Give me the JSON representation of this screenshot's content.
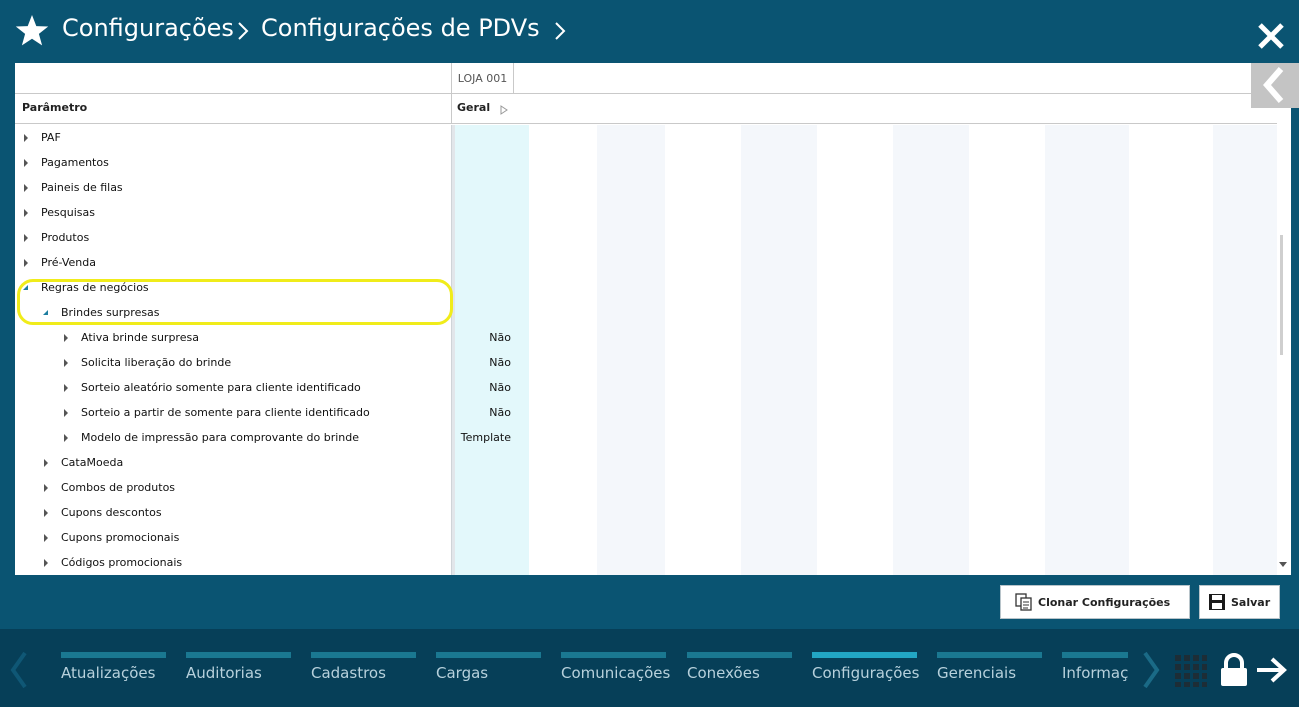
{
  "header": {
    "crumbs": [
      "Configurações",
      "Configurações de PDVs"
    ]
  },
  "table": {
    "store_column": "LOJA 001",
    "param_header": "Parâmetro",
    "group_header": "Geral",
    "rows": [
      {
        "label": "PAF",
        "level": 0,
        "state": "closed",
        "value": ""
      },
      {
        "label": "Pagamentos",
        "level": 0,
        "state": "closed",
        "value": ""
      },
      {
        "label": "Paineis de filas",
        "level": 0,
        "state": "closed",
        "value": ""
      },
      {
        "label": "Pesquisas",
        "level": 0,
        "state": "closed",
        "value": ""
      },
      {
        "label": "Produtos",
        "level": 0,
        "state": "closed",
        "value": ""
      },
      {
        "label": "Pré-Venda",
        "level": 0,
        "state": "closed",
        "value": ""
      },
      {
        "label": "Regras de negócios",
        "level": 0,
        "state": "open",
        "value": ""
      },
      {
        "label": "Brindes surpresas",
        "level": 1,
        "state": "open",
        "value": ""
      },
      {
        "label": "Ativa brinde surpresa",
        "level": 2,
        "state": "closed",
        "value": "Não"
      },
      {
        "label": "Solicita liberação do brinde",
        "level": 2,
        "state": "closed",
        "value": "Não"
      },
      {
        "label": "Sorteio aleatório somente para cliente identificado",
        "level": 2,
        "state": "closed",
        "value": "Não"
      },
      {
        "label": "Sorteio a partir de somente para cliente identificado",
        "level": 2,
        "state": "closed",
        "value": "Não"
      },
      {
        "label": "Modelo de impressão para comprovante do brinde",
        "level": 2,
        "state": "closed",
        "value": "Template"
      },
      {
        "label": "CataMoeda",
        "level": 1,
        "state": "closed",
        "value": ""
      },
      {
        "label": "Combos de produtos",
        "level": 1,
        "state": "closed",
        "value": ""
      },
      {
        "label": "Cupons descontos",
        "level": 1,
        "state": "closed",
        "value": ""
      },
      {
        "label": "Cupons promocionais",
        "level": 1,
        "state": "closed",
        "value": ""
      },
      {
        "label": "Códigos promocionais",
        "level": 1,
        "state": "closed",
        "value": ""
      }
    ]
  },
  "actions": {
    "clone_label": "Clonar Configurações",
    "save_label": "Salvar"
  },
  "bottom_nav": {
    "items": [
      {
        "label": "Atualizações",
        "active": false
      },
      {
        "label": "Auditorias",
        "active": false
      },
      {
        "label": "Cadastros",
        "active": false
      },
      {
        "label": "Cargas",
        "active": false
      },
      {
        "label": "Comunicações",
        "active": false
      },
      {
        "label": "Conexões",
        "active": false
      },
      {
        "label": "Configurações",
        "active": true
      },
      {
        "label": "Gerenciais",
        "active": false
      },
      {
        "label": "Informaç",
        "active": false
      }
    ]
  },
  "colors": {
    "background": "#0a5472",
    "nav_background": "#063f58",
    "nav_bar": "#1a7891",
    "nav_bar_active": "#22a6c4",
    "highlight": "#f0ec1a",
    "geral_column": "#e3f8fb",
    "alt_column": "#f4f7fb"
  }
}
